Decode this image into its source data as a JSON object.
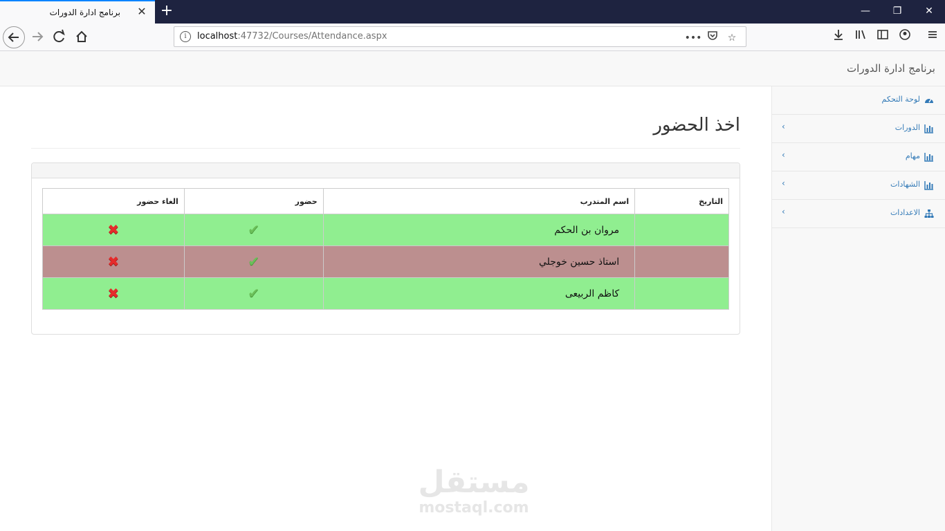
{
  "browser": {
    "tab_title": "برنامج ادارة الدورات",
    "url_host": "localhost",
    "url_rest": ":47732/Courses/Attendance.aspx"
  },
  "app": {
    "brand": "برنامج ادارة الدورات"
  },
  "sidebar": {
    "items": [
      {
        "label": "لوحة التحكم",
        "icon": "dashboard-icon"
      },
      {
        "label": "الدورات",
        "icon": "bar-chart-icon"
      },
      {
        "label": "مهام",
        "icon": "bar-chart-icon"
      },
      {
        "label": "الشهادات",
        "icon": "bar-chart-icon"
      },
      {
        "label": "الاعدادات",
        "icon": "sitemap-icon"
      }
    ]
  },
  "main": {
    "title": "اخذ الحضور",
    "table": {
      "headers": [
        "التاريخ",
        "اسم المتدرب",
        "حضور",
        "الغاء حضور"
      ],
      "rows": [
        {
          "date": "",
          "name": "مروان بن الحكم",
          "status": "green"
        },
        {
          "date": "",
          "name": "استاذ حسين خوجلي",
          "status": "brown"
        },
        {
          "date": "",
          "name": "كاظم الربيعى",
          "status": "green"
        }
      ]
    }
  },
  "colors": {
    "present_row": "#90ee90",
    "absent_row": "#bc8f8f",
    "link": "#337ab7"
  },
  "watermark": {
    "arabic": "مستقل",
    "latin": "mostaql.com"
  }
}
